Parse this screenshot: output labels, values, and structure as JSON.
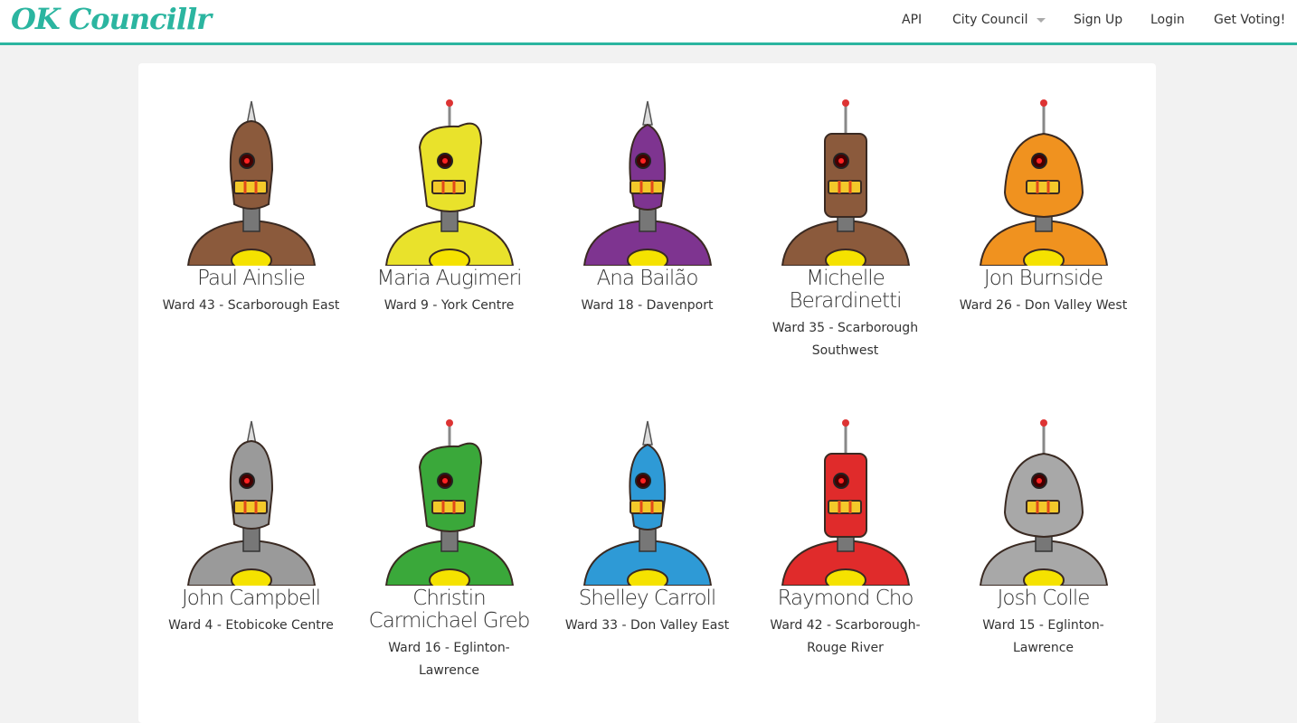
{
  "brand": "OK Councillr",
  "nav": {
    "api": "API",
    "city_council": "City Council",
    "sign_up": "Sign Up",
    "login": "Login",
    "get_voting": "Get Voting!"
  },
  "councillors": [
    {
      "name": "Paul Ainslie",
      "ward": "Ward 43 - Scarborough East",
      "robot_color": "#8b5a3c",
      "avatar": "brown-spike-robot"
    },
    {
      "name": "Maria Augimeri",
      "ward": "Ward 9 - York Centre",
      "robot_color": "#e9e22b",
      "avatar": "yellow-robot"
    },
    {
      "name": "Ana Bailão",
      "ward": "Ward 18 - Davenport",
      "robot_color": "#7e3490",
      "avatar": "purple-spike-robot"
    },
    {
      "name": "Michelle Berardinetti",
      "ward": "Ward 35 - Scarborough Southwest",
      "robot_color": "#8b5a3c",
      "avatar": "brown-antenna-robot"
    },
    {
      "name": "Jon Burnside",
      "ward": "Ward 26 - Don Valley West",
      "robot_color": "#f0921f",
      "avatar": "orange-robot"
    },
    {
      "name": "John Campbell",
      "ward": "Ward 4 - Etobicoke Centre",
      "robot_color": "#9a9a9a",
      "avatar": "grey-mop-robot"
    },
    {
      "name": "Christin Carmichael Greb",
      "ward": "Ward 16 - Eglinton-Lawrence",
      "robot_color": "#3aa83a",
      "avatar": "green-robot"
    },
    {
      "name": "Shelley Carroll",
      "ward": "Ward 33 - Don Valley East",
      "robot_color": "#2e9ad6",
      "avatar": "blue-tv-antenna-robot"
    },
    {
      "name": "Raymond Cho",
      "ward": "Ward 42 - Scarborough-Rouge River",
      "robot_color": "#e02b2b",
      "avatar": "red-robot"
    },
    {
      "name": "Josh Colle",
      "ward": "Ward 15 - Eglinton-Lawrence",
      "robot_color": "#a8a8a8",
      "avatar": "grey-antenna-robot"
    }
  ]
}
